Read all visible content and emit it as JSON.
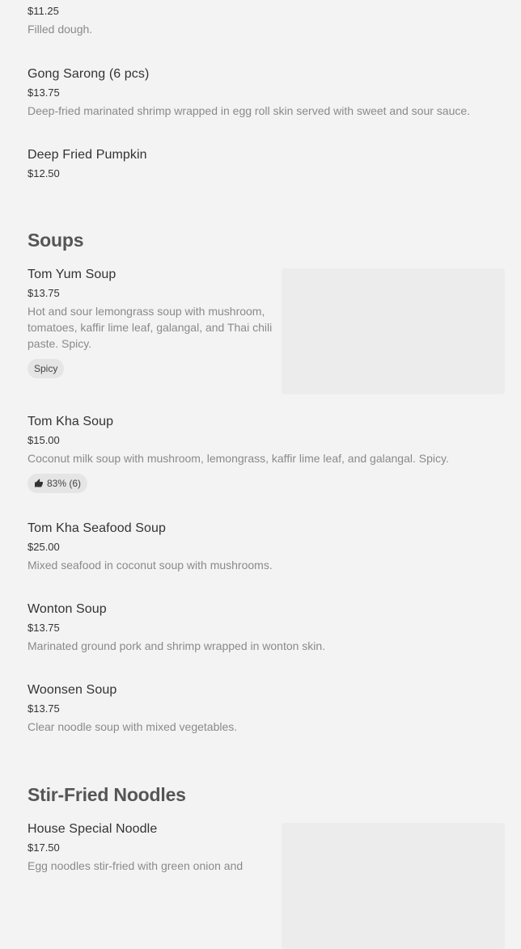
{
  "items_top": [
    {
      "name": "",
      "price": "$11.25",
      "desc": "Filled dough."
    },
    {
      "name": "Gong Sarong (6 pcs)",
      "price": "$13.75",
      "desc": "Deep-fried marinated shrimp wrapped in egg roll skin served with sweet and sour sauce."
    },
    {
      "name": "Deep Fried Pumpkin",
      "price": "$12.50",
      "desc": ""
    }
  ],
  "soups": {
    "title": "Soups",
    "items": [
      {
        "name": "Tom Yum Soup",
        "price": "$13.75",
        "desc": "Hot and sour lemongrass soup with mushroom, tomatoes, kaffir lime leaf, galangal, and Thai chili paste. Spicy.",
        "tag": "Spicy"
      },
      {
        "name": "Tom Kha Soup",
        "price": "$15.00",
        "desc": "Coconut milk soup with mushroom, lemongrass, kaffir lime leaf, and galangal. Spicy.",
        "rating": "83% (6)"
      },
      {
        "name": "Tom Kha Seafood Soup",
        "price": "$25.00",
        "desc": "Mixed seafood in coconut soup with mushrooms."
      },
      {
        "name": "Wonton Soup",
        "price": "$13.75",
        "desc": "Marinated ground pork and shrimp wrapped in wonton skin."
      },
      {
        "name": "Woonsen Soup",
        "price": "$13.75",
        "desc": "Clear noodle soup with mixed vegetables."
      }
    ]
  },
  "noodles": {
    "title": "Stir-Fried Noodles",
    "items": [
      {
        "name": "House Special Noodle",
        "price": "$17.50",
        "desc": "Egg noodles stir-fried with green onion and"
      }
    ]
  },
  "icons": {
    "thumb": "thumbs-up-icon"
  }
}
